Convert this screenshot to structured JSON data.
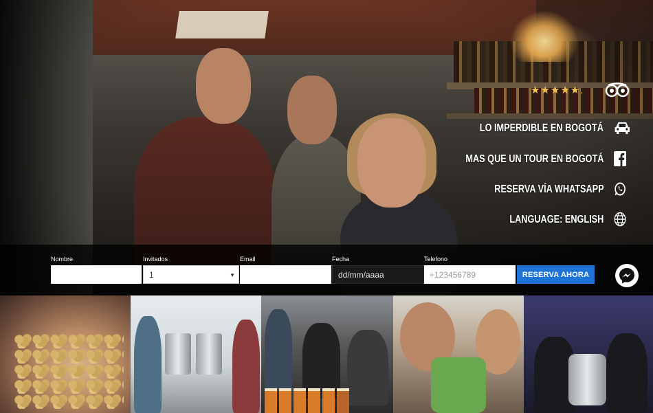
{
  "rating": {
    "stars": "★★★★★",
    "suffix": ".",
    "source_icon": "tripadvisor-icon"
  },
  "menu": [
    {
      "label": "LO IMPERDIBLE EN BOGOTÁ",
      "icon": "car-icon"
    },
    {
      "label": "MAS QUE UN TOUR EN BOGOTÁ",
      "icon": "facebook-icon"
    },
    {
      "label": "RESERVA VÍA WHATSAPP",
      "icon": "whatsapp-icon"
    },
    {
      "label": "LANGUAGE: ENGLISH",
      "icon": "globe-icon"
    }
  ],
  "booking": {
    "name": {
      "label": "Nombre",
      "value": ""
    },
    "guests": {
      "label": "Invitados",
      "value": "1"
    },
    "email": {
      "label": "Email",
      "value": ""
    },
    "date": {
      "label": "Fecha",
      "placeholder": "dd/mm/aaaa"
    },
    "phone": {
      "label": "Telefono",
      "placeholder": "+123456789"
    },
    "submit_label": "RESERVA AHORA",
    "accent": "#1e73d6"
  },
  "chat": {
    "icon": "messenger-icon"
  }
}
